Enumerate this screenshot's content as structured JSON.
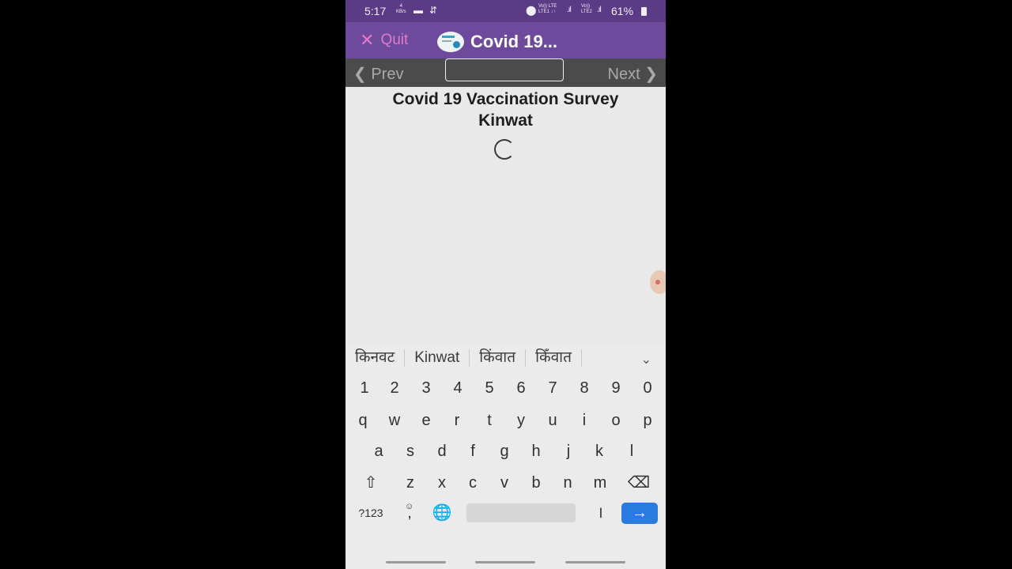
{
  "status": {
    "time": "5:17",
    "net_speed_top": "4",
    "net_speed_unit": "KB/s",
    "sim1_label_top": "Vo)) LTE",
    "sim1_label_bottom": "LTE1 ↓↑",
    "sim2_label_top": "Vo))",
    "sim2_label_bottom": "LTE2",
    "battery": "61%"
  },
  "appbar": {
    "quit_label": "Quit",
    "title": "Covid 19..."
  },
  "nav": {
    "prev_label": "Prev",
    "next_label": "Next"
  },
  "survey": {
    "title_line1": "Covid 19 Vaccination Survey",
    "title_line2": "Kinwat"
  },
  "keyboard": {
    "suggestions": [
      "किनवट",
      "Kinwat",
      "किंवात",
      "किँवात"
    ],
    "row_numbers": [
      "1",
      "2",
      "3",
      "4",
      "5",
      "6",
      "7",
      "8",
      "9",
      "0"
    ],
    "row1": [
      "q",
      "w",
      "e",
      "r",
      "t",
      "y",
      "u",
      "i",
      "o",
      "p"
    ],
    "row2": [
      "a",
      "s",
      "d",
      "f",
      "g",
      "h",
      "j",
      "k",
      "l"
    ],
    "row3": [
      "z",
      "x",
      "c",
      "v",
      "b",
      "n",
      "m"
    ],
    "symbols_label": "?123",
    "comma_label": ",",
    "period_label": "।",
    "enter_arrow": "→"
  },
  "colors": {
    "appbar": "#6d4a9b",
    "statusbar": "#5b3b85",
    "quit": "#e37ac9",
    "enter": "#2a7be0"
  }
}
